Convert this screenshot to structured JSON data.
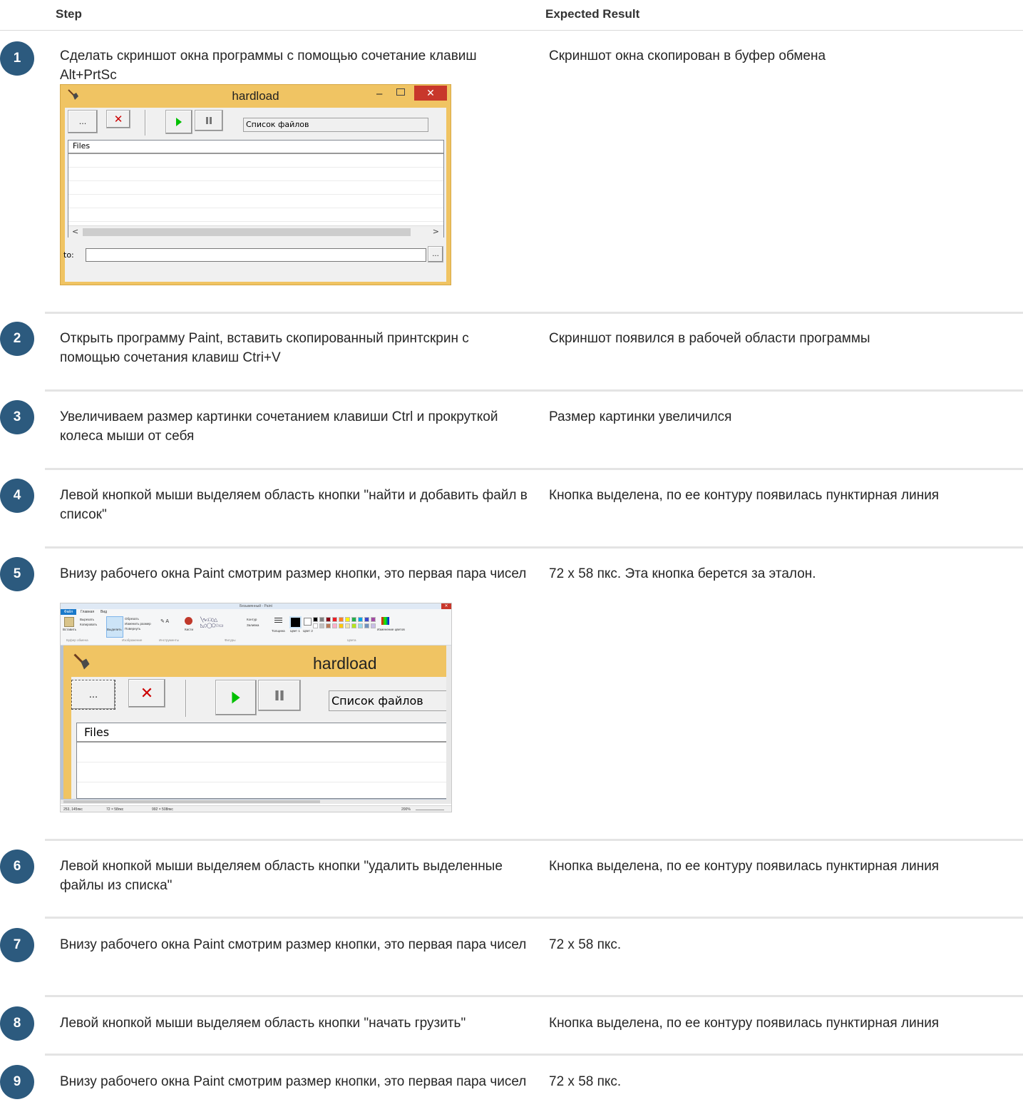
{
  "header": {
    "step_label": "Step",
    "result_label": "Expected Result"
  },
  "steps": [
    {
      "num": "1",
      "text": "Сделать скриншот окна программы с помощью сочетание клавиш Alt+PrtSc",
      "result": "Скриншот окна скопирован в буфер обмена"
    },
    {
      "num": "2",
      "text": "Открыть программу Paint, вставить скопированный принтскрин с помощью сочетания клавиш Ctri+V",
      "result": "Скриншот появился в рабочей области программы"
    },
    {
      "num": "3",
      "text": "Увеличиваем размер картинки сочетанием клавиши Ctrl и прокруткой колеса мыши от себя",
      "result": "Размер картинки увеличился"
    },
    {
      "num": "4",
      "text": "Левой кнопкой мыши выделяем область кнопки \"найти и добавить файл в список\"",
      "result": "Кнопка выделена, по ее контуру появилась пунктирная линия"
    },
    {
      "num": "5",
      "text": "Внизу рабочего окна Paint смотрим размер кнопки, это первая пара чисел",
      "result": "72 x 58 пкс. Эта кнопка берется за эталон."
    },
    {
      "num": "6",
      "text": "Левой кнопкой мыши выделяем область кнопки \"удалить выделенные файлы из списка\"",
      "result": "Кнопка выделена, по ее контуру появилась пунктирная линия"
    },
    {
      "num": "7",
      "text": "Внизу рабочего окна Paint смотрим размер кнопки, это первая пара чисел",
      "result": "72 x 58 пкс."
    },
    {
      "num": "8",
      "text": "Левой кнопкой мыши выделяем область кнопки \"начать грузить\"",
      "result": "Кнопка выделена, по ее контуру появилась пунктирная линия"
    },
    {
      "num": "9",
      "text": "Внизу рабочего окна Paint смотрим размер кнопки, это первая пара чисел",
      "result": "72 x 58 пкс."
    }
  ],
  "hardload": {
    "title": "hardload",
    "browse_label": "...",
    "delete_label": "✕",
    "combo_value": "Список файлов",
    "list_header": "Files",
    "to_label": "to:",
    "to_browse_label": "..."
  },
  "paint": {
    "title": "Безымянный - Paint",
    "tabs": [
      "Файл",
      "Главная",
      "Вид"
    ],
    "ribbon": {
      "paste": "Вставить",
      "cut": "Вырезать",
      "copy": "Копировать",
      "select": "Выделить",
      "crop": "Обрезать",
      "resize": "Изменить размер",
      "rotate": "Повернуть",
      "brushes": "Кисти",
      "outline": "Контур",
      "fill": "Заливка",
      "thickness": "Толщина",
      "color1": "Цвет 1",
      "color2": "Цвет 2",
      "edit_colors": "Изменение цветов",
      "group_clipboard": "Буфер обмена",
      "group_image": "Изображение",
      "group_tools": "Инструменты",
      "group_shapes": "Фигуры",
      "group_colors": "Цвета"
    },
    "status": {
      "coords": "253, 145пкс",
      "selection": "72 × 58пкс",
      "size": "992 × 508пкс",
      "zoom": "200%"
    },
    "palette": [
      "#000000",
      "#7f7f7f",
      "#880015",
      "#ed1c24",
      "#ff7f27",
      "#fff200",
      "#22b14c",
      "#00a2e8",
      "#3f48cc",
      "#a349a4",
      "#ffffff",
      "#c3c3c3",
      "#b97a57",
      "#ffaec9",
      "#ffc90e",
      "#efe4b0",
      "#b5e61d",
      "#99d9ea",
      "#7092be",
      "#c8bfe7"
    ]
  },
  "colors": {
    "badge": "#2c5a7e",
    "window_title_bar": "#f0c463",
    "close_button": "#c8372b",
    "play_green": "#00c000",
    "delete_red": "#cc0000"
  }
}
